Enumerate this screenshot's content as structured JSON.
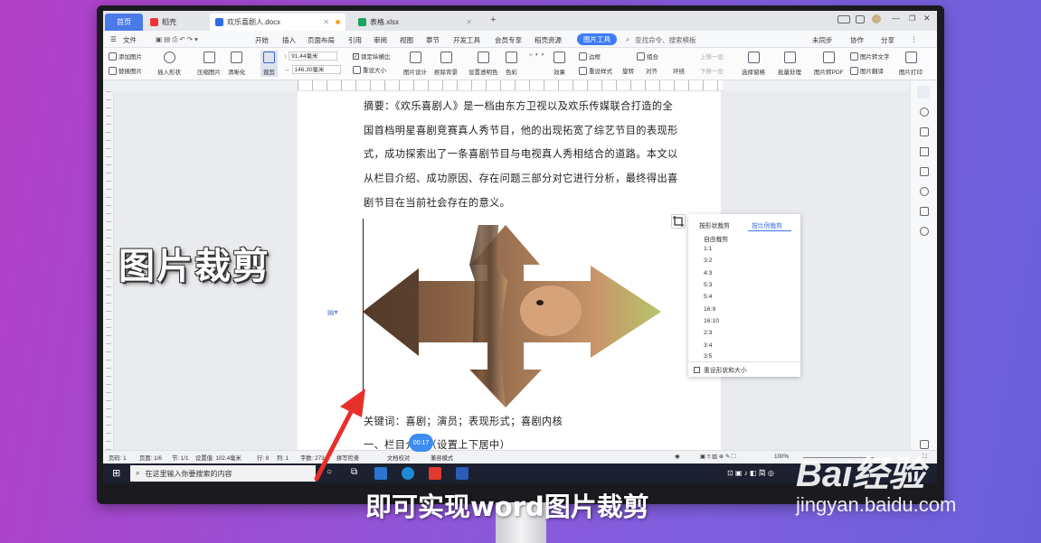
{
  "tabs": [
    {
      "label": "首页"
    },
    {
      "label": "稻壳"
    },
    {
      "label": "欢乐喜剧人.docx"
    },
    {
      "label": "表格.xlsx"
    }
  ],
  "menu": {
    "file": "文件",
    "items": [
      "开始",
      "插入",
      "页面布局",
      "引用",
      "审阅",
      "视图",
      "章节",
      "开发工具",
      "会员专享",
      "稻壳资源"
    ],
    "active": "图片工具",
    "search": "查找命令、搜索模板",
    "sync": "未同步",
    "collab": "协作",
    "share": "分享"
  },
  "ribbon": {
    "add_image": "添加图片",
    "replace_image": "替换图片",
    "insert_shape": "插入形状",
    "compress": "压缩图片",
    "sharpen": "清晰化",
    "crop": "裁剪",
    "height": "91.44毫米",
    "width": "146.30毫米",
    "lock_ratio": "锁定纵横比",
    "reset_size": "重设大小",
    "image_design": "图片设计",
    "remove_bg": "抠除背景",
    "transparent": "设置透明色",
    "color": "色彩",
    "effects": "效果",
    "reset_style": "重设样式",
    "border": "边框",
    "combine": "组合",
    "rotate": "旋转",
    "align": "对齐",
    "wrap": "环绕",
    "up": "上移一层",
    "down": "下移一层",
    "select_pane": "选择窗格",
    "batch": "批量处理",
    "to_pdf": "图片转PDF",
    "translate": "图片翻译",
    "to_text": "图片转文字",
    "print": "图片打印"
  },
  "document": {
    "lines": [
      "摘要：《欢乐喜剧人》是一档由东方卫视以及欢乐传媒联合打造的全",
      "国首档明星喜剧竞赛真人秀节目，他的出现拓宽了综艺节目的表现形",
      "式，成功探索出了一条喜剧节目与电视真人秀相结合的道路。本文以",
      "从栏目介绍、成功原因、存在问题三部分对它进行分析，最终得出喜",
      "剧节目在当前社会存在的意义。"
    ],
    "keywords": "关键词：喜剧；演员；表现形式；喜剧内核",
    "section": "一、栏目介绍（设置上下居中）"
  },
  "crop_panel": {
    "tab_shape": "按形状裁剪",
    "tab_ratio": "按比例裁剪",
    "free": "自由裁剪",
    "ratios": [
      "1:1",
      "3:2",
      "4:3",
      "5:3",
      "5:4",
      "16:9",
      "16:10",
      "2:3",
      "3:4",
      "3:5"
    ],
    "reset": "重设形状和大小"
  },
  "status": {
    "page_num": "页码: 1",
    "page": "页面: 1/6",
    "section": "节: 1/1",
    "position": "设置值: 102.4毫米",
    "row": "行: 8",
    "col": "列: 1",
    "words": "字数: 273",
    "spell": "拼写检查",
    "proof": "文档校对",
    "compat": "兼容模式",
    "zoom": "100%"
  },
  "taskbar": {
    "search": "在这里输入你要搜索的内容"
  },
  "timer": "00:17",
  "overlay": {
    "title": "图片裁剪",
    "subtitle": "即可实现word图片裁剪",
    "watermark": "Bai经验",
    "watermark_url": "jingyan.baidu.com"
  }
}
